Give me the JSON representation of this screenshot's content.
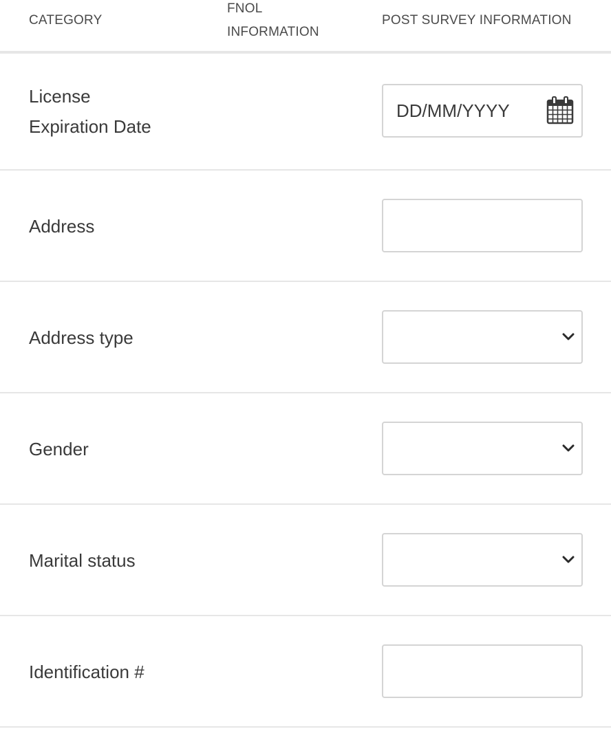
{
  "header": {
    "category": "CATEGORY",
    "fnol_line1": "FNOL",
    "fnol_line2": "INFORMATION",
    "post_survey": "POST SURVEY INFORMATION"
  },
  "rows": [
    {
      "label_line1": "License",
      "label_line2": "Expiration Date",
      "field_type": "date",
      "value": "",
      "placeholder": "DD/MM/YYYY",
      "icon": "calendar-icon"
    },
    {
      "label": "Address",
      "field_type": "text",
      "value": ""
    },
    {
      "label": "Address type",
      "field_type": "select",
      "value": "",
      "icon": "chevron-down-icon"
    },
    {
      "label": "Gender",
      "field_type": "select",
      "value": "",
      "icon": "chevron-down-icon"
    },
    {
      "label": "Marital status",
      "field_type": "select",
      "value": "",
      "icon": "chevron-down-icon"
    },
    {
      "label": "Identification #",
      "field_type": "text",
      "value": ""
    }
  ],
  "colors": {
    "text": "#3a3a3a",
    "border": "#d4d4d4",
    "divider": "#e6e6e6"
  }
}
